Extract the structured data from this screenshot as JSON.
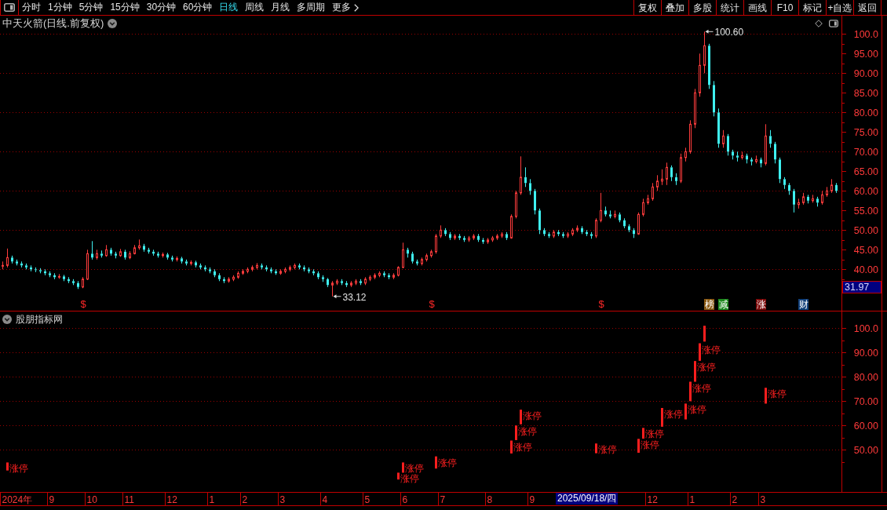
{
  "toolbar": {
    "periods": [
      {
        "label": "分时",
        "kind": "period",
        "selected": false
      },
      {
        "label": "1分钟",
        "kind": "period",
        "selected": false
      },
      {
        "label": "5分钟",
        "kind": "period",
        "selected": false
      },
      {
        "label": "15分钟",
        "kind": "period",
        "selected": false
      },
      {
        "label": "30分钟",
        "kind": "period",
        "selected": false
      },
      {
        "label": "60分钟",
        "kind": "period",
        "selected": false
      },
      {
        "label": "日线",
        "kind": "period",
        "selected": true
      },
      {
        "label": "周线",
        "kind": "period",
        "selected": false
      },
      {
        "label": "月线",
        "kind": "period",
        "selected": false
      },
      {
        "label": "多周期",
        "kind": "period",
        "selected": false
      },
      {
        "label": "更多",
        "kind": "menu",
        "selected": false
      }
    ],
    "buttons": [
      "复权",
      "叠加",
      "多股",
      "统计",
      "画线",
      "F10",
      "标记",
      "+自选",
      "返回"
    ]
  },
  "price_panel": {
    "title": "中天火箭(日线.前复权)",
    "axis_labels": [
      "100.0",
      "95.00",
      "90.00",
      "85.00",
      "80.00",
      "75.00",
      "70.00",
      "65.00",
      "60.00",
      "55.00",
      "50.00",
      "45.00",
      "40.00"
    ],
    "high_label": "100.60",
    "low_label": "33.12",
    "event_marks": [
      "$",
      "$",
      "$"
    ],
    "info_tiles": [
      {
        "text": "榜",
        "color": "#8b5a14"
      },
      {
        "text": "减",
        "color": "#1e8a1e"
      },
      {
        "text": "涨",
        "color": "#7c0a0a"
      },
      {
        "text": "财",
        "color": "#12407a"
      }
    ],
    "cursor_price": "31.97"
  },
  "indicator_panel": {
    "title": "股朋指标网",
    "axis_labels": [
      "100.0",
      "90.00",
      "80.00",
      "70.00",
      "60.00",
      "50.00"
    ],
    "signal_labels": [
      "涨停",
      "涨停",
      "涨停",
      "涨停",
      "涨停",
      "涨停",
      "涨停",
      "涨停",
      "涨停",
      "涨停",
      "涨停",
      "涨停",
      "涨停",
      "涨停",
      "涨停",
      "涨停"
    ]
  },
  "time_axis": {
    "labels": [
      "2024年",
      "9",
      "10",
      "11",
      "12",
      "1",
      "2",
      "3",
      "4",
      "5",
      "6",
      "7",
      "8",
      "9",
      "12",
      "1",
      "2",
      "3"
    ],
    "cursor_date": "2025/09/18/四"
  }
}
